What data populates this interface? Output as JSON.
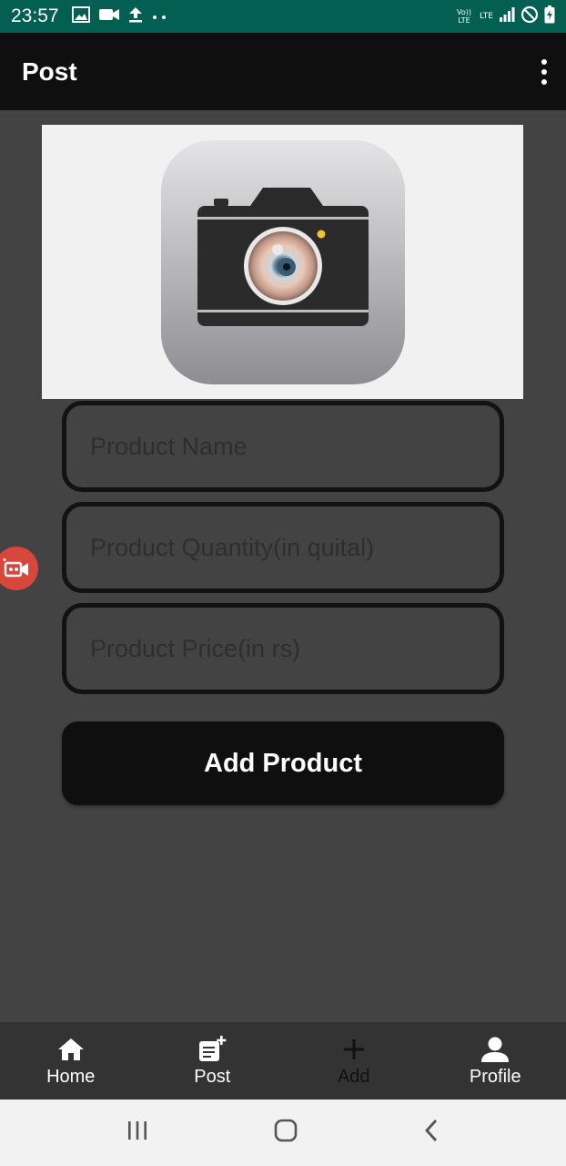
{
  "status_bar": {
    "time": "23:57",
    "network_1": "Vo)) LTE",
    "network_2": "LTE"
  },
  "app_bar": {
    "title": "Post"
  },
  "form": {
    "product_name_placeholder": "Product Name",
    "product_quantity_placeholder": "Product Quantity(in quital)",
    "product_price_placeholder": "Product Price(in rs)",
    "submit_label": "Add Product"
  },
  "bottom_nav": {
    "items": [
      {
        "label": "Home",
        "icon": "home-icon"
      },
      {
        "label": "Post",
        "icon": "post-add-icon"
      },
      {
        "label": "Add",
        "icon": "plus-icon"
      },
      {
        "label": "Profile",
        "icon": "person-icon"
      }
    ]
  },
  "colors": {
    "status_bar": "#035f52",
    "app_bar": "#0f0f0f",
    "background": "#434343",
    "nav_bar": "#333333",
    "record_button": "#d9463b"
  }
}
